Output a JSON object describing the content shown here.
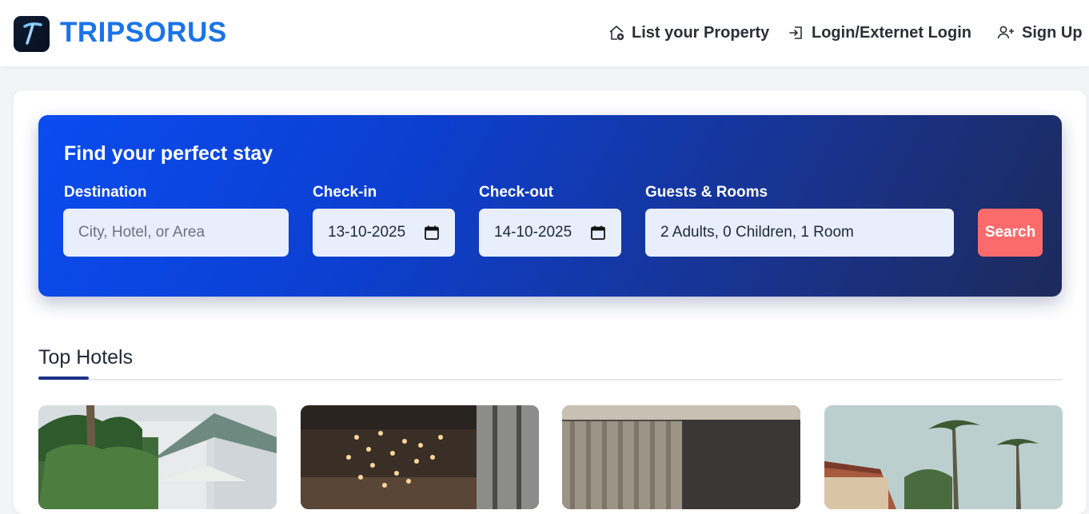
{
  "brand": {
    "name": "TRIPSORUS",
    "logo_letter": "T"
  },
  "nav": {
    "list_property": "List your Property",
    "login": "Login/Externet Login",
    "signup": "Sign Up"
  },
  "search": {
    "title": "Find your perfect stay",
    "destination_label": "Destination",
    "destination_placeholder": "City, Hotel, or Area",
    "checkin_label": "Check-in",
    "checkin_value": "13-10-2025",
    "checkout_label": "Check-out",
    "checkout_value": "14-10-2025",
    "guests_label": "Guests & Rooms",
    "guests_value": "2 Adults, 0 Children, 1 Room",
    "button": "Search"
  },
  "top_hotels": {
    "title": "Top Hotels"
  },
  "colors": {
    "brand": "#1a74e8",
    "search_button": "#fb6b6b",
    "accent": "#1a3288"
  }
}
